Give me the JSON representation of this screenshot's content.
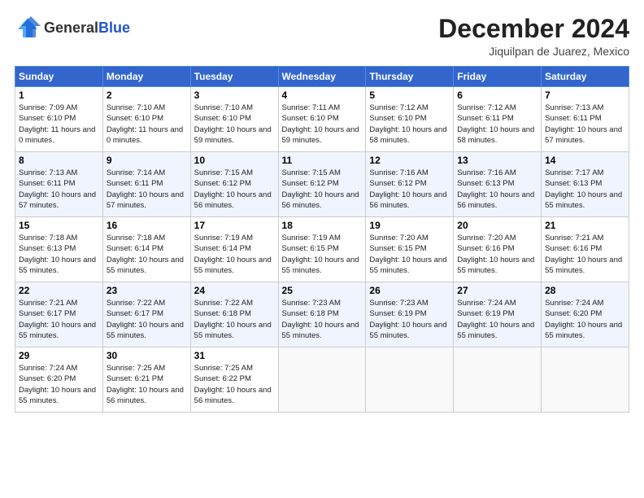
{
  "header": {
    "logo_general": "General",
    "logo_blue": "Blue",
    "month_title": "December 2024",
    "subtitle": "Jiquilpan de Juarez, Mexico"
  },
  "calendar": {
    "days_of_week": [
      "Sunday",
      "Monday",
      "Tuesday",
      "Wednesday",
      "Thursday",
      "Friday",
      "Saturday"
    ],
    "weeks": [
      [
        null,
        null,
        null,
        null,
        null,
        null,
        null
      ],
      [
        null,
        null,
        null,
        null,
        null,
        null,
        null
      ],
      [
        null,
        null,
        null,
        null,
        null,
        null,
        null
      ],
      [
        null,
        null,
        null,
        null,
        null,
        null,
        null
      ],
      [
        null,
        null,
        null,
        null,
        null,
        null,
        null
      ],
      [
        null,
        null,
        null,
        null,
        null,
        null,
        null
      ]
    ],
    "cells": [
      {
        "day": 1,
        "dow": 0,
        "sunrise": "7:09 AM",
        "sunset": "6:10 PM",
        "daylight": "11 hours and 0 minutes."
      },
      {
        "day": 2,
        "dow": 1,
        "sunrise": "7:10 AM",
        "sunset": "6:10 PM",
        "daylight": "11 hours and 0 minutes."
      },
      {
        "day": 3,
        "dow": 2,
        "sunrise": "7:10 AM",
        "sunset": "6:10 PM",
        "daylight": "10 hours and 59 minutes."
      },
      {
        "day": 4,
        "dow": 3,
        "sunrise": "7:11 AM",
        "sunset": "6:10 PM",
        "daylight": "10 hours and 59 minutes."
      },
      {
        "day": 5,
        "dow": 4,
        "sunrise": "7:12 AM",
        "sunset": "6:10 PM",
        "daylight": "10 hours and 58 minutes."
      },
      {
        "day": 6,
        "dow": 5,
        "sunrise": "7:12 AM",
        "sunset": "6:11 PM",
        "daylight": "10 hours and 58 minutes."
      },
      {
        "day": 7,
        "dow": 6,
        "sunrise": "7:13 AM",
        "sunset": "6:11 PM",
        "daylight": "10 hours and 57 minutes."
      },
      {
        "day": 8,
        "dow": 0,
        "sunrise": "7:13 AM",
        "sunset": "6:11 PM",
        "daylight": "10 hours and 57 minutes."
      },
      {
        "day": 9,
        "dow": 1,
        "sunrise": "7:14 AM",
        "sunset": "6:11 PM",
        "daylight": "10 hours and 57 minutes."
      },
      {
        "day": 10,
        "dow": 2,
        "sunrise": "7:15 AM",
        "sunset": "6:12 PM",
        "daylight": "10 hours and 56 minutes."
      },
      {
        "day": 11,
        "dow": 3,
        "sunrise": "7:15 AM",
        "sunset": "6:12 PM",
        "daylight": "10 hours and 56 minutes."
      },
      {
        "day": 12,
        "dow": 4,
        "sunrise": "7:16 AM",
        "sunset": "6:12 PM",
        "daylight": "10 hours and 56 minutes."
      },
      {
        "day": 13,
        "dow": 5,
        "sunrise": "7:16 AM",
        "sunset": "6:13 PM",
        "daylight": "10 hours and 56 minutes."
      },
      {
        "day": 14,
        "dow": 6,
        "sunrise": "7:17 AM",
        "sunset": "6:13 PM",
        "daylight": "10 hours and 55 minutes."
      },
      {
        "day": 15,
        "dow": 0,
        "sunrise": "7:18 AM",
        "sunset": "6:13 PM",
        "daylight": "10 hours and 55 minutes."
      },
      {
        "day": 16,
        "dow": 1,
        "sunrise": "7:18 AM",
        "sunset": "6:14 PM",
        "daylight": "10 hours and 55 minutes."
      },
      {
        "day": 17,
        "dow": 2,
        "sunrise": "7:19 AM",
        "sunset": "6:14 PM",
        "daylight": "10 hours and 55 minutes."
      },
      {
        "day": 18,
        "dow": 3,
        "sunrise": "7:19 AM",
        "sunset": "6:15 PM",
        "daylight": "10 hours and 55 minutes."
      },
      {
        "day": 19,
        "dow": 4,
        "sunrise": "7:20 AM",
        "sunset": "6:15 PM",
        "daylight": "10 hours and 55 minutes."
      },
      {
        "day": 20,
        "dow": 5,
        "sunrise": "7:20 AM",
        "sunset": "6:16 PM",
        "daylight": "10 hours and 55 minutes."
      },
      {
        "day": 21,
        "dow": 6,
        "sunrise": "7:21 AM",
        "sunset": "6:16 PM",
        "daylight": "10 hours and 55 minutes."
      },
      {
        "day": 22,
        "dow": 0,
        "sunrise": "7:21 AM",
        "sunset": "6:17 PM",
        "daylight": "10 hours and 55 minutes."
      },
      {
        "day": 23,
        "dow": 1,
        "sunrise": "7:22 AM",
        "sunset": "6:17 PM",
        "daylight": "10 hours and 55 minutes."
      },
      {
        "day": 24,
        "dow": 2,
        "sunrise": "7:22 AM",
        "sunset": "6:18 PM",
        "daylight": "10 hours and 55 minutes."
      },
      {
        "day": 25,
        "dow": 3,
        "sunrise": "7:23 AM",
        "sunset": "6:18 PM",
        "daylight": "10 hours and 55 minutes."
      },
      {
        "day": 26,
        "dow": 4,
        "sunrise": "7:23 AM",
        "sunset": "6:19 PM",
        "daylight": "10 hours and 55 minutes."
      },
      {
        "day": 27,
        "dow": 5,
        "sunrise": "7:24 AM",
        "sunset": "6:19 PM",
        "daylight": "10 hours and 55 minutes."
      },
      {
        "day": 28,
        "dow": 6,
        "sunrise": "7:24 AM",
        "sunset": "6:20 PM",
        "daylight": "10 hours and 55 minutes."
      },
      {
        "day": 29,
        "dow": 0,
        "sunrise": "7:24 AM",
        "sunset": "6:20 PM",
        "daylight": "10 hours and 55 minutes."
      },
      {
        "day": 30,
        "dow": 1,
        "sunrise": "7:25 AM",
        "sunset": "6:21 PM",
        "daylight": "10 hours and 56 minutes."
      },
      {
        "day": 31,
        "dow": 2,
        "sunrise": "7:25 AM",
        "sunset": "6:22 PM",
        "daylight": "10 hours and 56 minutes."
      }
    ]
  }
}
